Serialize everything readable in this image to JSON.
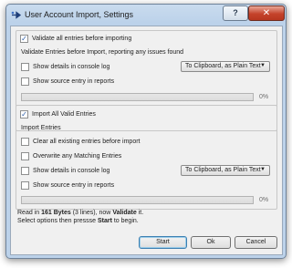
{
  "window": {
    "title": "User Account Import, Settings",
    "help_label": "?",
    "close_label": "✕"
  },
  "validate": {
    "toggle_label": "Validate all entries before importing",
    "toggle_checked": true,
    "description": "Validate Entries before Import, reporting any issues found",
    "show_details_label": "Show details in console log",
    "show_details_checked": false,
    "output_select": "To Clipboard, as Plain Text",
    "show_source_label": "Show source entry in reports",
    "show_source_checked": false,
    "progress_percent": 0,
    "progress_label": "0%"
  },
  "import": {
    "toggle_label": "Import All Valid Entries",
    "toggle_checked": true,
    "section_heading": "Import Entries",
    "clear_label": "Clear all existing entries before import",
    "clear_checked": false,
    "overwrite_label": "Overwrite any Matching Entries",
    "overwrite_checked": false,
    "show_details_label": "Show details in console log",
    "show_details_checked": false,
    "output_select": "To Clipboard, as Plain Text",
    "show_source_label": "Show source entry in reports",
    "show_source_checked": false,
    "progress_percent": 0,
    "progress_label": "0%"
  },
  "status": {
    "line1_prefix": "Read in ",
    "line1_size": "161 Bytes",
    "line1_middle": " (3 lines), now ",
    "line1_action": "Validate",
    "line1_suffix": " it.",
    "line2_prefix": "Select options then pressse ",
    "line2_action": "Start",
    "line2_suffix": " to begin."
  },
  "buttons": {
    "start": "Start",
    "ok": "Ok",
    "cancel": "Cancel"
  },
  "colors": {
    "title_bar": "#bcd2ea",
    "close_button": "#c5432b",
    "dialog_body": "#f0f0f0",
    "check_mark": "#2a5ca8"
  }
}
